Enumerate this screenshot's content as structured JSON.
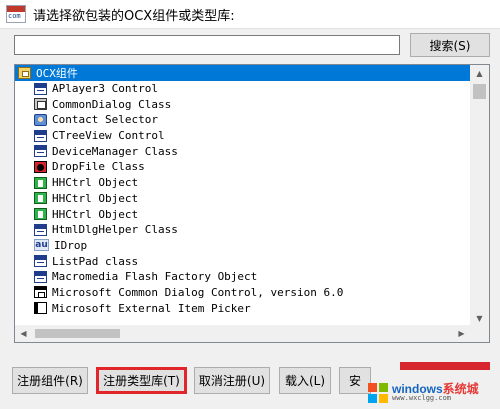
{
  "window": {
    "title": "请选择欲包装的OCX组件或类型库:",
    "app_icon_text": "com"
  },
  "search": {
    "value": "",
    "button_label": "搜索(S)"
  },
  "list": {
    "group": "OCX组件",
    "items": [
      {
        "label": "APlayer3 Control",
        "icon": "ocx-icon"
      },
      {
        "label": "CommonDialog Class",
        "icon": "dialog-icon"
      },
      {
        "label": "Contact Selector",
        "icon": "contact-icon"
      },
      {
        "label": "CTreeView Control",
        "icon": "ocx-icon"
      },
      {
        "label": "DeviceManager Class",
        "icon": "ocx-icon"
      },
      {
        "label": "DropFile Class",
        "icon": "dropfile-icon"
      },
      {
        "label": "HHCtrl Object",
        "icon": "hh-icon"
      },
      {
        "label": "HHCtrl Object",
        "icon": "hh-icon"
      },
      {
        "label": "HHCtrl Object",
        "icon": "hh-icon"
      },
      {
        "label": "HtmlDlgHelper Class",
        "icon": "ocx-icon"
      },
      {
        "label": "IDrop",
        "icon": "au-icon"
      },
      {
        "label": "ListPad class",
        "icon": "ocx-icon"
      },
      {
        "label": "Macromedia Flash Factory Object",
        "icon": "ocx-icon"
      },
      {
        "label": "Microsoft Common Dialog Control, version 6.0",
        "icon": "cd-icon"
      },
      {
        "label": "Microsoft External Item Picker",
        "icon": "ext-icon"
      }
    ]
  },
  "buttons": {
    "register_component": "注册组件(R)",
    "register_typelib": "注册类型库(T)",
    "unregister": "取消注册(U)",
    "load": "载入(L)",
    "install": "安"
  },
  "watermark": {
    "brand_prefix": "windows",
    "brand_suffix": "系统城",
    "site": "windows系统城",
    "url": "www.wxclgg.com"
  },
  "colors": {
    "selection": "#0078d7",
    "highlight_box": "#e0252b"
  }
}
